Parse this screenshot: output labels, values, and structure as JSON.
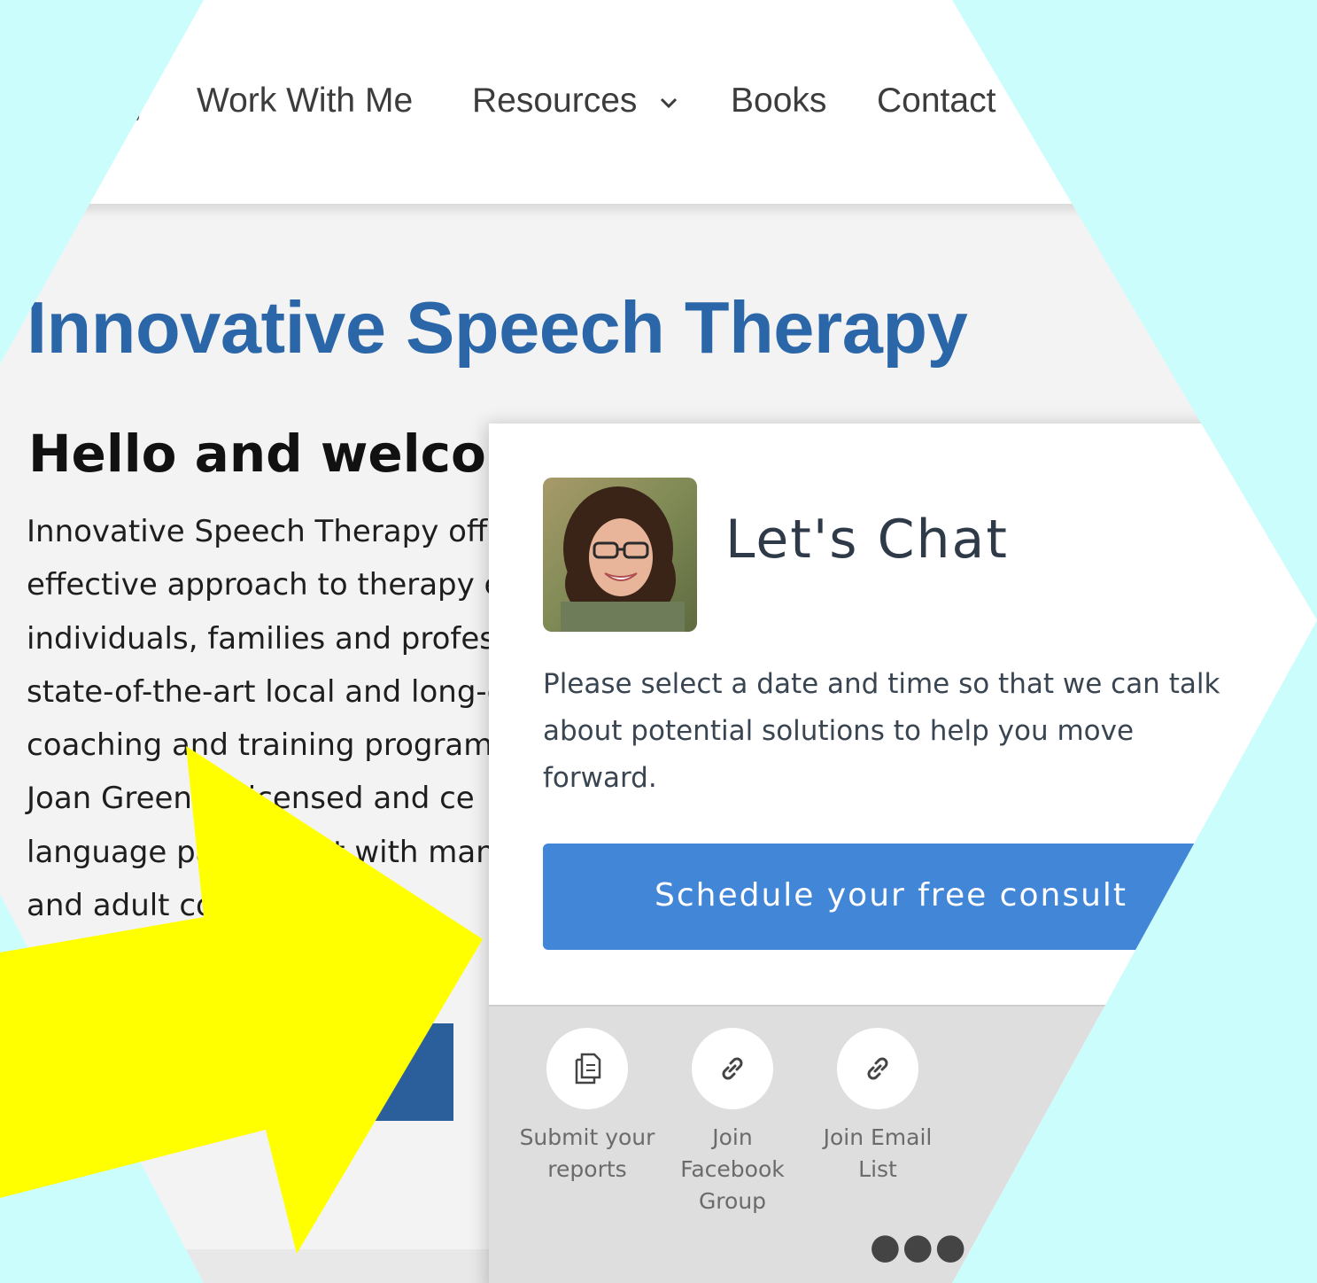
{
  "nav": {
    "separator": ",",
    "items": [
      {
        "label": "Work With Me"
      },
      {
        "label": "Resources"
      },
      {
        "label": "Books"
      },
      {
        "label": "Contact"
      }
    ],
    "resources_chevron": "⌄"
  },
  "page": {
    "title": "Innovative Speech Therapy",
    "welcome": "Hello and welcom",
    "body_lines": [
      "Innovative Speech Therapy offe",
      "effective approach to therapy e",
      "individuals, families and profes",
      "state-of-the-art local and long-c",
      "coaching and training programs",
      "Joan Green, a licensed and ce",
      "language pathologist with many",
      "and adult communi"
    ]
  },
  "chat": {
    "title": "Let's Chat",
    "description": "Please select a date and time so that we can talk about potential solutions to help you move forward.",
    "button_label": "Schedule your free consult",
    "actions": [
      {
        "label": "Submit your reports",
        "icon": "documents-icon"
      },
      {
        "label": "Join Facebook Group",
        "icon": "link-icon"
      },
      {
        "label": "Join Email List",
        "icon": "link-icon"
      }
    ],
    "more_label": "●●●"
  },
  "colors": {
    "background": "#ccfdfd",
    "title_blue": "#2a66a8",
    "button_blue": "#4286d8",
    "arrow_yellow": "#ffff00"
  }
}
